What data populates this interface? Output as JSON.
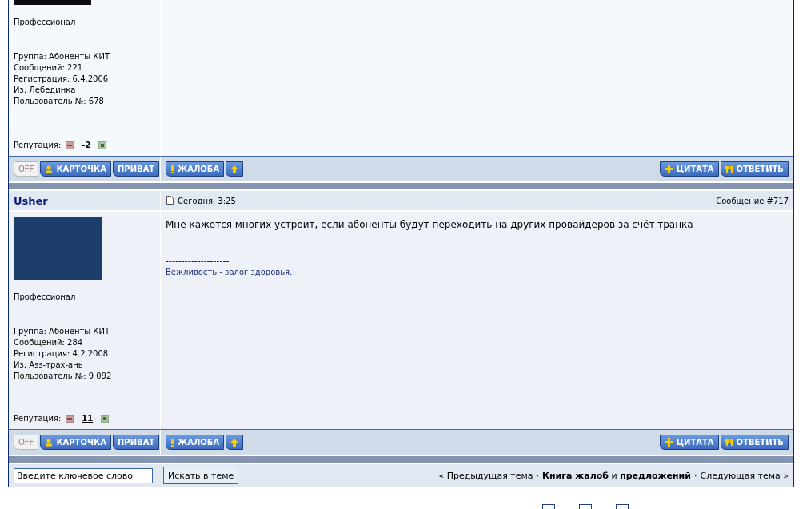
{
  "posts": [
    {
      "avatar_cut": true,
      "rank": "Профессионал",
      "info": [
        "Группа: Абоненты КИТ",
        "Сообщений: 221",
        "Регистрация: 6.4.2006",
        "Из: Лебединка",
        "Пользователь №: 678"
      ],
      "reputation_label": "Репутация:",
      "reputation": "-2",
      "online": false,
      "status_label": "OFF",
      "profile_button": "КАРТОЧКА",
      "pm_button": "ПРИВАТ",
      "report_button": "ЖАЛОБА",
      "quote_button": "ЦИТАТА",
      "reply_button": "ОТВЕТИТЬ"
    },
    {
      "author": "Usher",
      "date": "Сегодня, 3:25",
      "number_label": "Сообщение",
      "number": "#717",
      "avatar_cut": false,
      "rank": "Профессионал",
      "info": [
        "Группа: Абоненты КИТ",
        "Сообщений: 284",
        "Регистрация: 4.2.2008",
        "Из: Ass-трах-ань",
        "Пользователь №: 9 092"
      ],
      "reputation_label": "Репутация:",
      "reputation": "11",
      "body": "Мне кажется многих устроит, если абоненты будут переходить на других провайдеров за счёт транка",
      "signature_rule": "--------------------",
      "signature": "Вежливость - залог здоровья.",
      "online": false,
      "status_label": "OFF",
      "profile_button": "КАРТОЧКА",
      "pm_button": "ПРИВАТ",
      "report_button": "ЖАЛОБА",
      "quote_button": "ЦИТАТА",
      "reply_button": "ОТВЕТИТЬ"
    }
  ],
  "search": {
    "value": "Введите ключевое слово",
    "button": "Искать в теме"
  },
  "topic_nav": {
    "previous": "« Предыдущая тема",
    "separator_1": "·",
    "current": "**Книга жалоб** и **предложений**",
    "separator_2": "·",
    "next": "Следующая тема »"
  }
}
